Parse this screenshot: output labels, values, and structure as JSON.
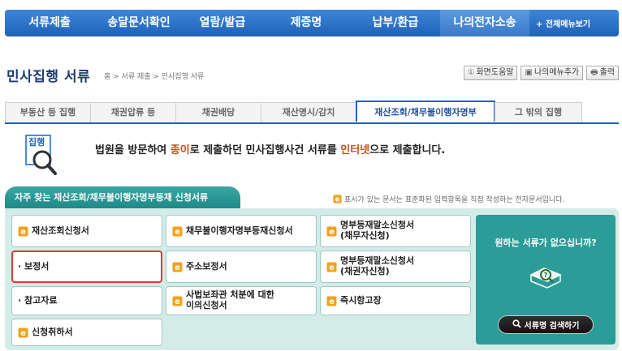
{
  "topnav": {
    "items": [
      "서류제출",
      "송달문서확인",
      "열람/발급",
      "제증명",
      "납부/환급",
      "나의전자소송"
    ],
    "all_menu": "+ 전체메뉴보기"
  },
  "header": {
    "title": "민사집행 서류",
    "breadcrumb": "홈 > 서류 제출 > 민사집행 서류",
    "help_btn": "화면도움말",
    "add_menu_btn": "나의메뉴추가",
    "print_btn": "출력"
  },
  "tabs": [
    "부동산 등 집행",
    "채권압류 등",
    "채권배당",
    "재산명시/감치",
    "재산조회/채무불이행자명부",
    "그 밖의 집행"
  ],
  "intro": {
    "part1": "법원을 방문하여 ",
    "part2": "종이",
    "part3": "로 제출하던 민사집행사건 서류를 ",
    "part4": "인터넷",
    "part5": "으로 제출합니다.",
    "icon_label": "집행"
  },
  "section": {
    "title": "자주 찾는 재산조회/채무불이행자명부등재 신청서류",
    "note": "표시가 있는 문서는 표준화된 입력항목을 직접 작성하는 전자문서입니다."
  },
  "docs": [
    {
      "label": "재산조회신청서",
      "e": true
    },
    {
      "label": "채무불이행자명부등재신청서",
      "e": true
    },
    {
      "label": "명부등재말소신청서",
      "label2": "(채무자신청)",
      "e": true
    },
    {
      "label": "· 보정서",
      "e": false
    },
    {
      "label": "주소보정서",
      "e": true
    },
    {
      "label": "명부등재말소신청서",
      "label2": "(채권자신청)",
      "e": true
    },
    {
      "label": "· 참고자료",
      "e": false
    },
    {
      "label": "사법보좌관 처분에 대한",
      "label2": "이의신청서",
      "e": true
    },
    {
      "label": "즉시항고장",
      "e": true
    },
    {
      "label": "신청취하서",
      "e": true
    }
  ],
  "side": {
    "question": "원하는 서류가 없으십니까?",
    "search_btn": "서류명 검색하기"
  },
  "colors": {
    "nav": "#1f62b8",
    "teal": "#2b9c98",
    "highlight": "#d24a1e",
    "e_icon": "#f0a21a"
  }
}
